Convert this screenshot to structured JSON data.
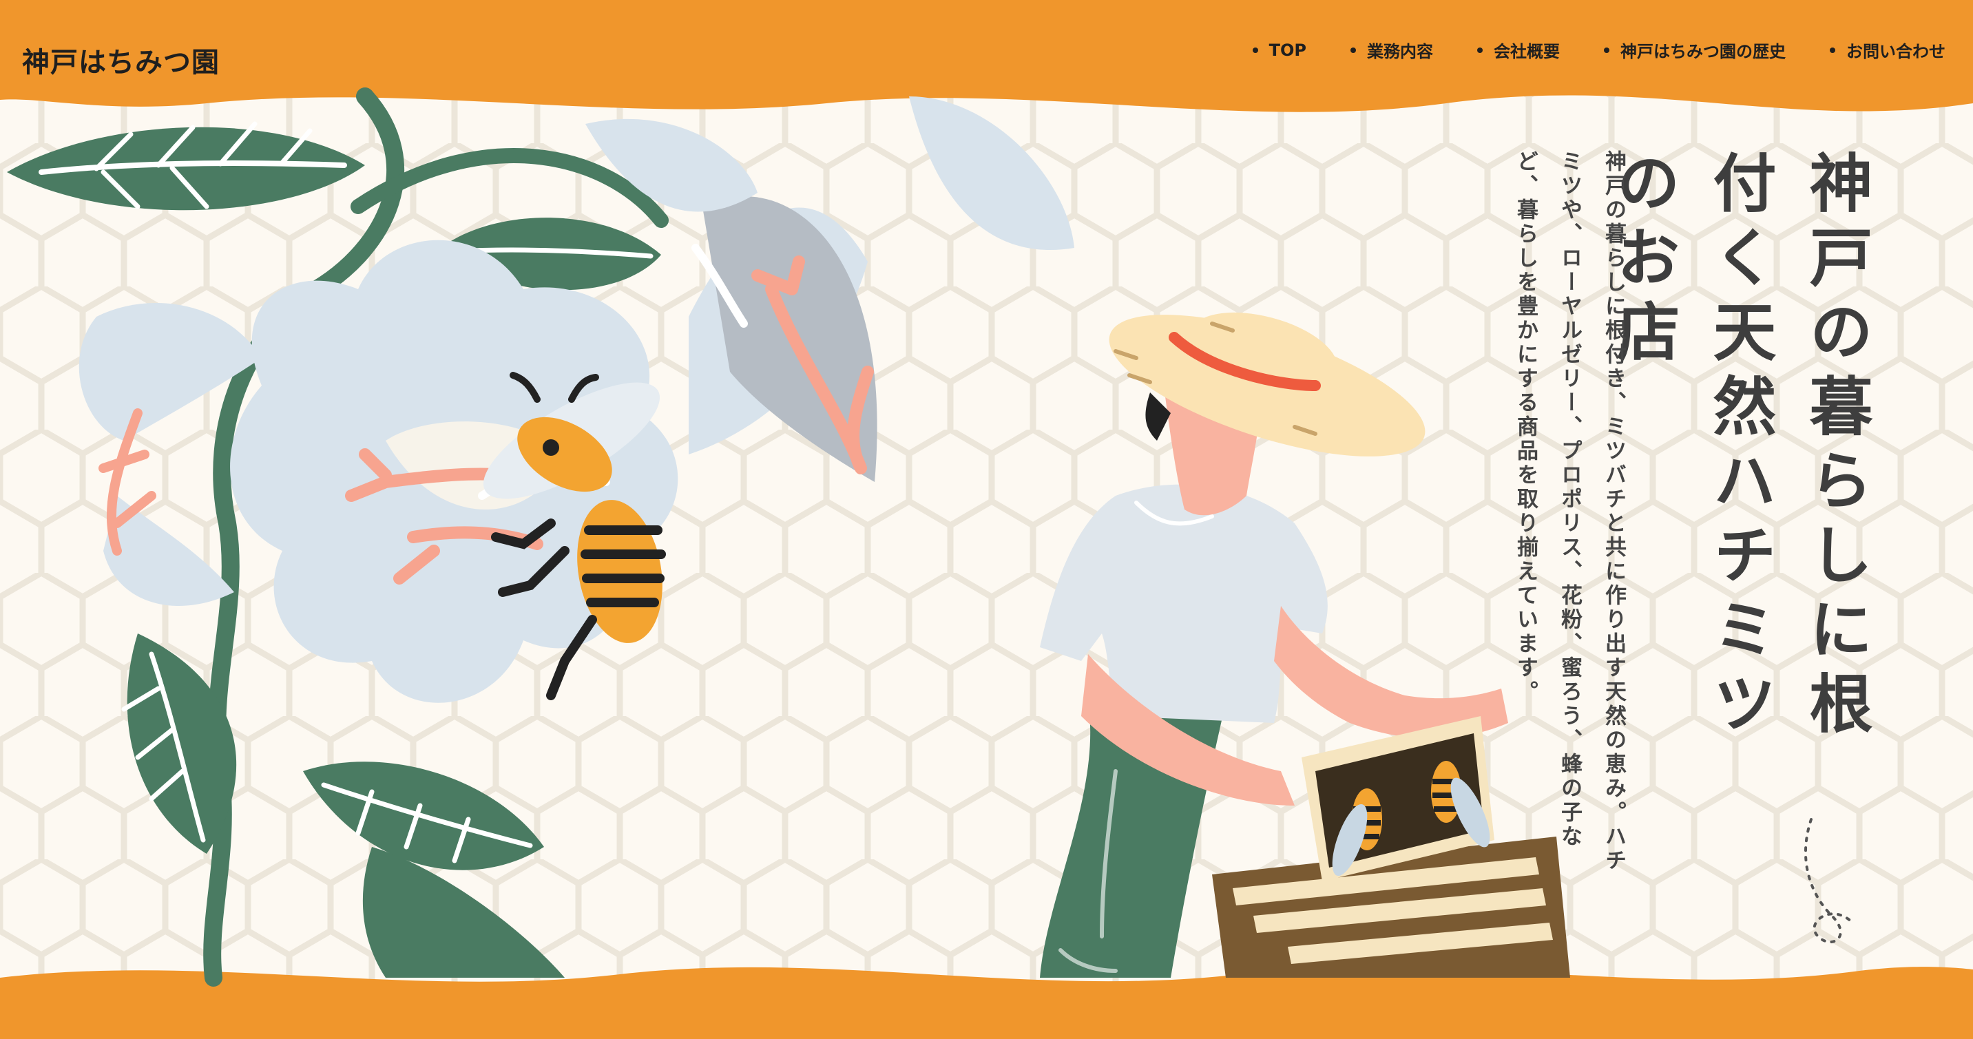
{
  "site": {
    "title": "神戸はちみつ園"
  },
  "nav": {
    "items": [
      {
        "label": "TOP"
      },
      {
        "label": "業務内容"
      },
      {
        "label": "会社概要"
      },
      {
        "label": "神戸はちみつ園の歴史"
      },
      {
        "label": "お問い合わせ"
      }
    ]
  },
  "hero": {
    "headline": "神戸の暮らしに根付く天然ハチミツのお店",
    "lead": "神戸の暮らしに根付き、ミツバチと共に作り出す天然の恵み。ハチミツや、ローヤルゼリー、プロポリス、花粉、蜜ろう、蜂の子など、暮らしを豊かにする商品を取り揃えています。"
  },
  "colors": {
    "accent": "#f0962c",
    "background": "#fdf9f2",
    "leaf": "#4a7b62",
    "petal": "#d8e3ec",
    "skin": "#f9b3a0",
    "hive": "#7a5a32",
    "text": "#3e3e3e"
  }
}
